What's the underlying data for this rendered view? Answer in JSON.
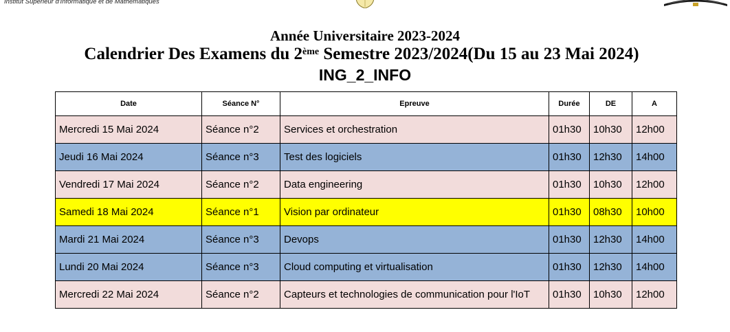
{
  "institute": "Institut Supérieur d'Informatique et de Mathématiques",
  "header": {
    "year_line": "Année Universitaire 2023-2024",
    "calendar_prefix": "Calendrier Des Examens du 2",
    "calendar_sup": "ème",
    "calendar_suffix": " Semestre 2023/2024(Du 15 au 23 Mai 2024)",
    "program": "ING_2_INFO"
  },
  "table": {
    "columns": [
      "Date",
      "Séance N°",
      "Epreuve",
      "Durée",
      "DE",
      "A"
    ],
    "rows": [
      {
        "color": "#f2dcdb",
        "date": "Mercredi 15 Mai 2024",
        "seance": "Séance n°2",
        "epreuve": "Services et orchestration",
        "duree": "01h30",
        "de": "10h30",
        "a": "12h00"
      },
      {
        "color": "#95b3d7",
        "date": "Jeudi 16 Mai 2024",
        "seance": "Séance n°3",
        "epreuve": "Test des logiciels",
        "duree": "01h30",
        "de": "12h30",
        "a": "14h00"
      },
      {
        "color": "#f2dcdb",
        "date": "Vendredi 17 Mai 2024",
        "seance": "Séance n°2",
        "epreuve": "Data engineering",
        "duree": "01h30",
        "de": "10h30",
        "a": "12h00"
      },
      {
        "color": "#ffff00",
        "date": "Samedi 18 Mai 2024",
        "seance": "Séance n°1",
        "epreuve": "Vision par ordinateur",
        "duree": "01h30",
        "de": "08h30",
        "a": "10h00"
      },
      {
        "color": "#95b3d7",
        "date": "Mardi 21 Mai 2024",
        "seance": "Séance n°3",
        "epreuve": "Devops",
        "duree": "01h30",
        "de": "12h30",
        "a": "14h00"
      },
      {
        "color": "#95b3d7",
        "date": "Lundi 20 Mai 2024",
        "seance": "Séance n°3",
        "epreuve": "Cloud computing et virtualisation",
        "duree": "01h30",
        "de": "12h30",
        "a": "14h00"
      },
      {
        "color": "#f2dcdb",
        "date": "Mercredi 22 Mai 2024",
        "seance": "Séance n°2",
        "epreuve": "Capteurs et technologies de communication pour l'IoT",
        "duree": "01h30",
        "de": "10h30",
        "a": "12h00"
      }
    ]
  }
}
